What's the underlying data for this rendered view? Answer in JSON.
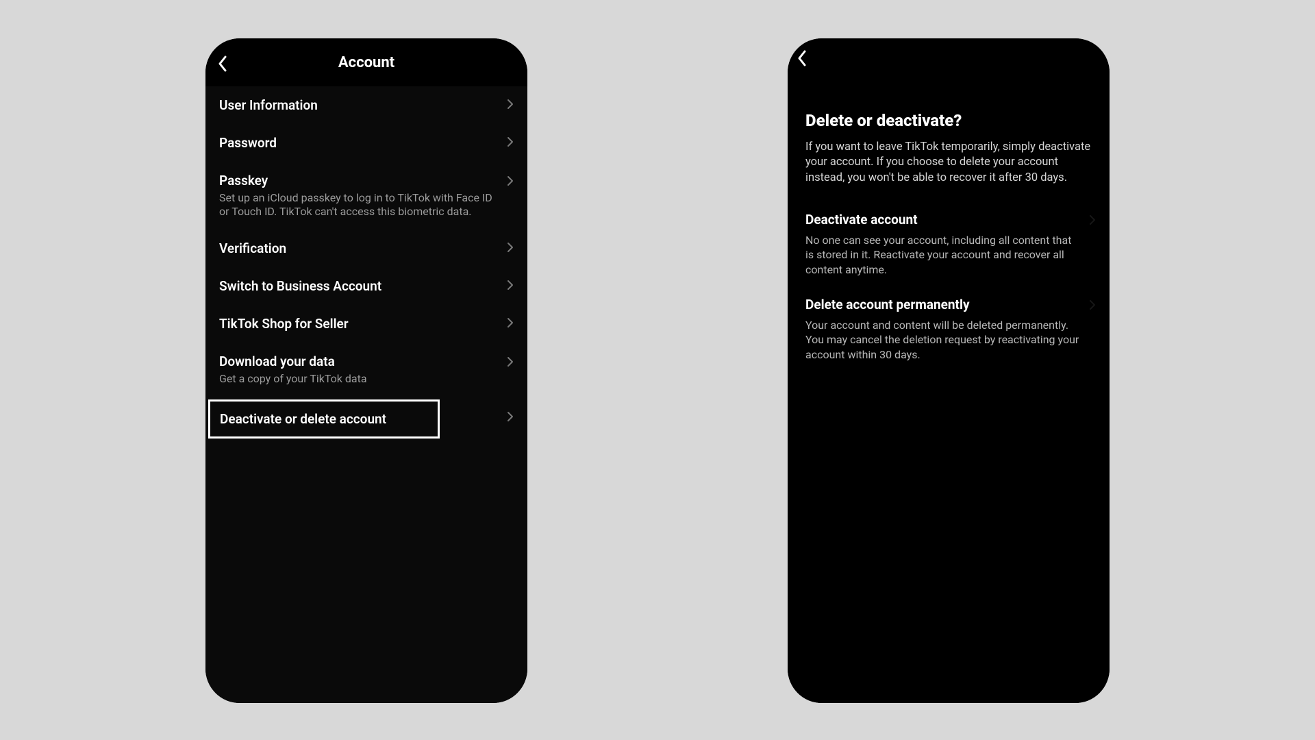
{
  "left": {
    "title": "Account",
    "items": [
      {
        "label": "User Information",
        "sub": ""
      },
      {
        "label": "Password",
        "sub": ""
      },
      {
        "label": "Passkey",
        "sub": "Set up an iCloud passkey to log in to TikTok with Face ID or Touch ID. TikTok can't access this biometric data."
      },
      {
        "label": "Verification",
        "sub": ""
      },
      {
        "label": "Switch to Business Account",
        "sub": ""
      },
      {
        "label": "TikTok Shop for Seller",
        "sub": ""
      },
      {
        "label": "Download your data",
        "sub": "Get a copy of your TikTok data"
      },
      {
        "label": "Deactivate or delete account",
        "sub": ""
      }
    ]
  },
  "right": {
    "heading": "Delete or deactivate?",
    "intro": "If you want to leave TikTok temporarily, simply deactivate your account. If you choose to delete your account instead, you won't be able to recover it after 30 days.",
    "options": [
      {
        "title": "Deactivate account",
        "desc": "No one can see your account, including all content that is stored in it. Reactivate your account and recover all content anytime."
      },
      {
        "title": "Delete account permanently",
        "desc": "Your account and content will be deleted permanently. You may cancel the deletion request by reactivating your account within 30 days."
      }
    ]
  }
}
